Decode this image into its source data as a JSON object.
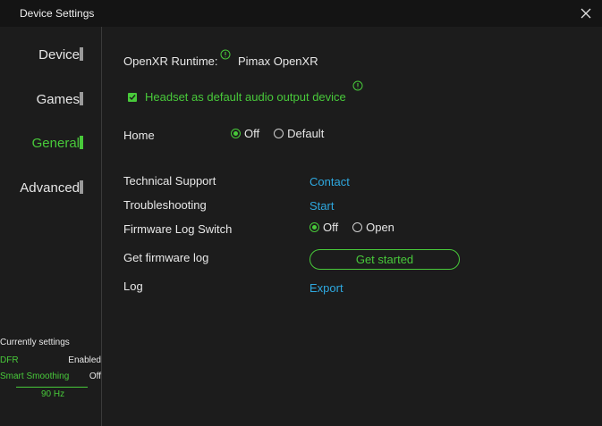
{
  "window": {
    "title": "Device Settings"
  },
  "icons": {
    "close": "close-icon",
    "info": "info-icon",
    "check": "check-icon"
  },
  "colors": {
    "accent": "#48c93a",
    "link": "#2ea8df",
    "background": "#1c1c1c"
  },
  "sidebar": {
    "items": [
      {
        "label": "Device"
      },
      {
        "label": "Games"
      },
      {
        "label": "General",
        "active": true
      },
      {
        "label": "Advanced"
      }
    ]
  },
  "current_settings": {
    "title": "Currently settings",
    "dfr": {
      "label": "DFR",
      "value": "Enabled"
    },
    "smart_smoothing": {
      "label": "Smart Smoothing",
      "value": "Off"
    },
    "refresh_rate": "90 Hz"
  },
  "general": {
    "openxr_label": "OpenXR Runtime:",
    "openxr_value": "Pimax OpenXR",
    "headset_audio_label": "Headset as default audio output device",
    "headset_audio_checked": true,
    "home": {
      "label": "Home",
      "options": [
        "Off",
        "Default"
      ],
      "selected": "Off"
    },
    "technical_support": {
      "label": "Technical Support",
      "action": "Contact"
    },
    "troubleshooting": {
      "label": "Troubleshooting",
      "action": "Start"
    },
    "firmware_log_switch": {
      "label": "Firmware Log Switch",
      "options": [
        "Off",
        "Open"
      ],
      "selected": "Off"
    },
    "get_firmware_log": {
      "label": "Get firmware log",
      "button": "Get started"
    },
    "log": {
      "label": "Log",
      "action": "Export"
    }
  }
}
